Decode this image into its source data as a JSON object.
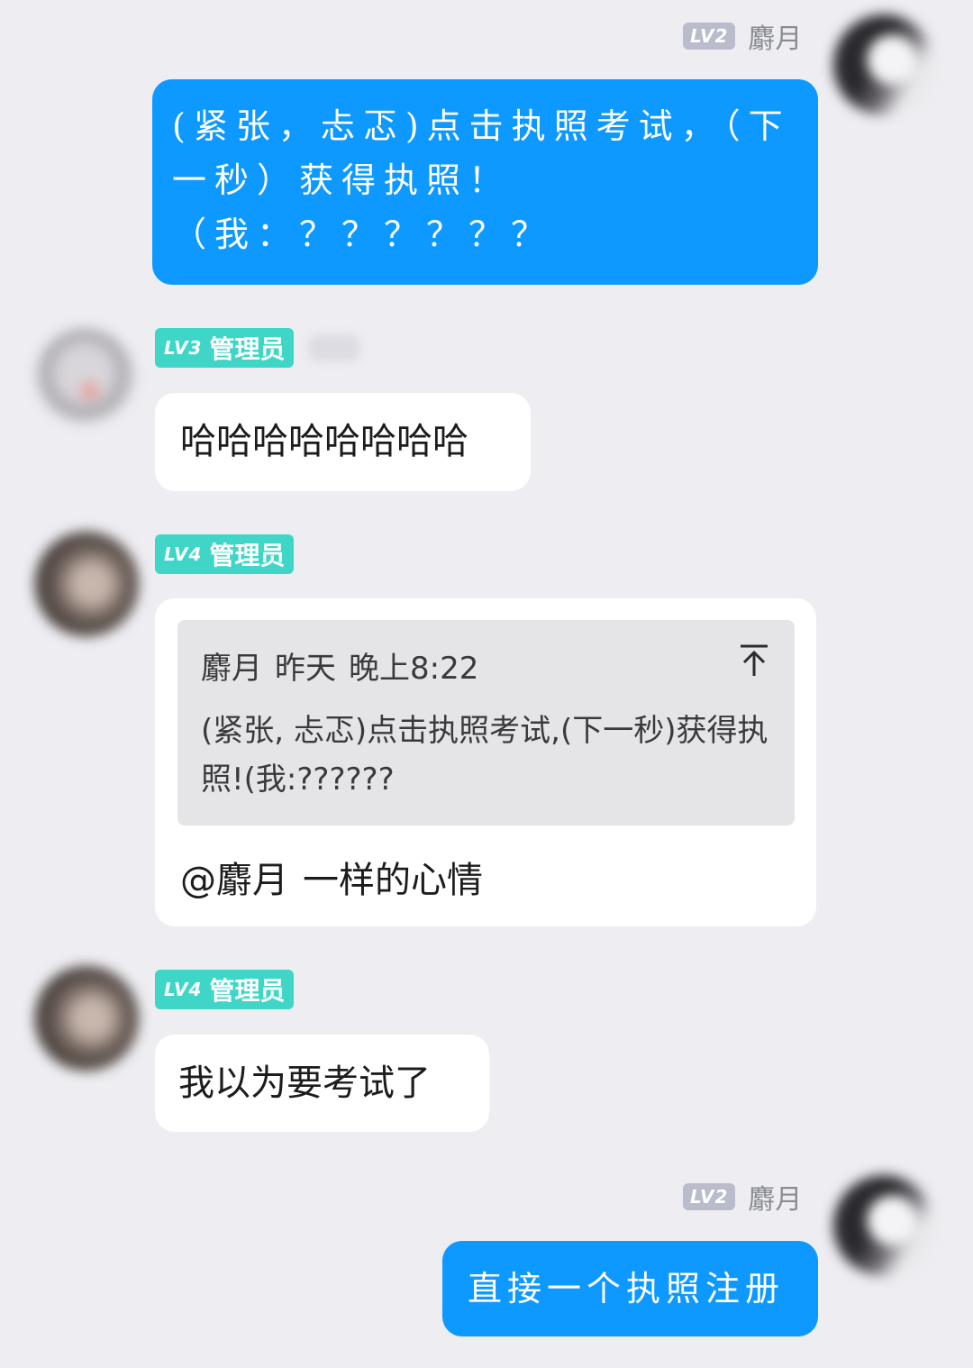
{
  "messages": [
    {
      "side": "right",
      "sender": {
        "level": "LV2",
        "name": "麝月"
      },
      "text": "(紧张，忐忑)点击执照考试，（下一秒）获得执照！（我：？？？？？？"
    },
    {
      "side": "left",
      "sender": {
        "level": "LV3",
        "role": "管理员"
      },
      "text": "哈哈哈哈哈哈哈哈"
    },
    {
      "side": "left",
      "sender": {
        "level": "LV4",
        "role": "管理员"
      },
      "quote": {
        "author": "麝月",
        "day": "昨天",
        "time": "晚上8:22",
        "text": "(紧张, 忐忑)点击执照考试,(下一秒)获得执照!(我:??????"
      },
      "mention": "@麝月",
      "text": "一样的心情"
    },
    {
      "side": "left",
      "sender": {
        "level": "LV4",
        "role": "管理员"
      },
      "text": "我以为要考试了"
    },
    {
      "side": "right",
      "sender": {
        "level": "LV2",
        "name": "麝月"
      },
      "text": "直接一个执照注册"
    }
  ],
  "icons": {
    "collapse_quote": "arrow-up-to-top-icon"
  },
  "colors": {
    "background": "#eeeef2",
    "my_bubble": "#0d99ff",
    "other_bubble": "#ffffff",
    "admin_badge": "#3fd6c8",
    "level_badge": "#b8bccb"
  }
}
